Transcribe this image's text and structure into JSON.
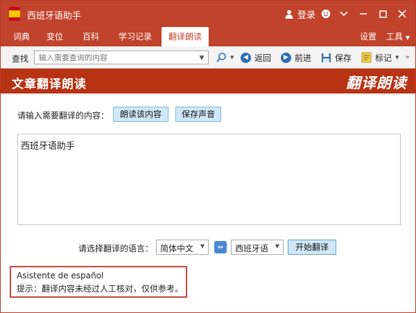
{
  "app": {
    "title": "西班牙语助手",
    "login_label": "登录"
  },
  "menu": {
    "tabs": [
      {
        "label": "词典"
      },
      {
        "label": "变位"
      },
      {
        "label": "百科"
      },
      {
        "label": "学习记录"
      },
      {
        "label": "翻译朗读"
      }
    ],
    "active_tab": "翻译朗读",
    "settings_label": "设置",
    "tools_label": "工具"
  },
  "toolbar": {
    "search_label": "查找",
    "search_placeholder": "输入需要查询的内容",
    "back_label": "返回",
    "forward_label": "前进",
    "save_label": "保存",
    "bookmark_label": "标记"
  },
  "banner": {
    "title": "文章翻译朗读",
    "right_title": "翻译朗读"
  },
  "content": {
    "prompt_label": "请输入需要翻译的内容：",
    "read_button": "朗读该内容",
    "save_audio_button": "保存声音",
    "input_text": "西班牙语助手",
    "lang_label": "请选择翻译的语言：",
    "source_lang": "简体中文",
    "target_lang": "西班牙语",
    "translate_button": "开始翻译"
  },
  "result": {
    "line1": "Asistente de español",
    "line2": "提示：翻译内容未经过人工核对，仅供参考。"
  },
  "colors": {
    "brand": "#c1432c",
    "banner": "#b83214",
    "button_bg": "#cfe8f7",
    "highlight_border": "#c9453c"
  }
}
